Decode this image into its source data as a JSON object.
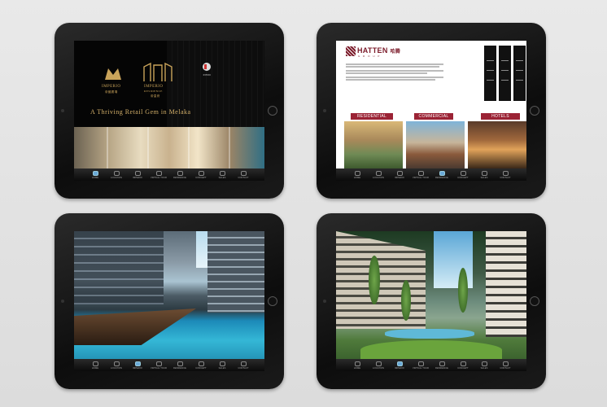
{
  "tablet1": {
    "logo_imperio": "IMPERIO",
    "logo_imperio_sub": "帝國廣場",
    "logo_residence": "IMPERIO",
    "logo_residence_line2": "RESIDENCE",
    "logo_residence_sub": "帝皇府",
    "tagline": "A Thriving Retail Gem in Melaka",
    "intro_label": "INTRO"
  },
  "tablet2": {
    "brand": "HATTEN",
    "brand_cjk": "哈腾",
    "brand_sub": "G R O U P",
    "categories": [
      "RESIDENTIAL",
      "COMMERCIAL",
      "HOTELS"
    ],
    "award_count": 3
  },
  "nav": {
    "labels": [
      "HOME",
      "LOCATION",
      "IMPERIO",
      "VIRTUAL TOUR",
      "RESIDENCE",
      "CONCEPT",
      "SALES",
      "CONTACT"
    ]
  },
  "colors": {
    "gold": "#d4b06a",
    "hatten_red": "#9b2335",
    "nav_active": "#6aa9d8"
  }
}
